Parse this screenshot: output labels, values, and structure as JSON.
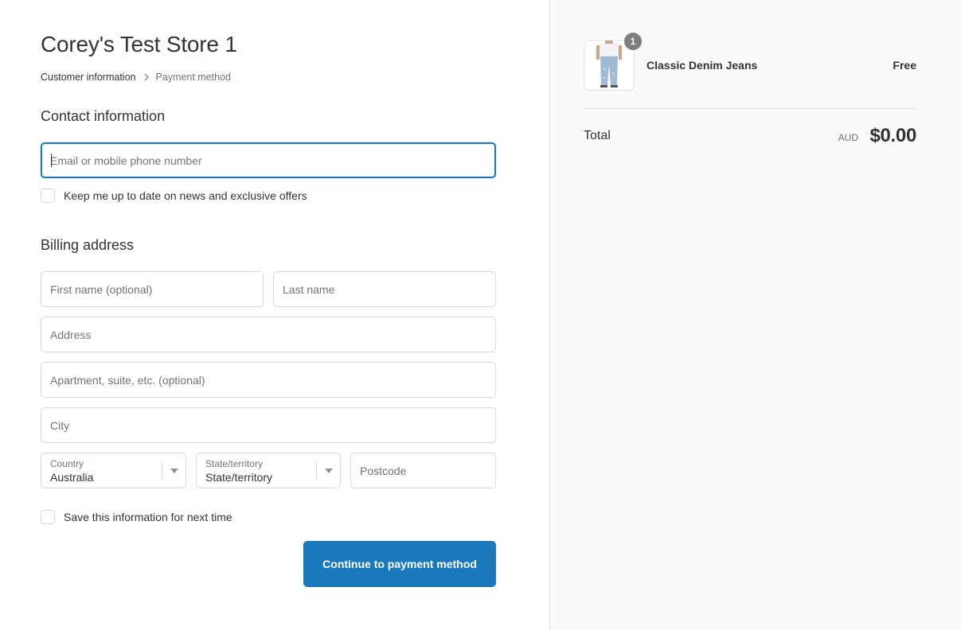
{
  "store": {
    "title": "Corey's Test Store 1"
  },
  "breadcrumb": {
    "current": "Customer information",
    "next": "Payment method"
  },
  "contact": {
    "section_title": "Contact information",
    "email_placeholder": "Email or mobile phone number",
    "email_value": "",
    "newsletter_label": "Keep me up to date on news and exclusive offers",
    "newsletter_checked": false
  },
  "billing": {
    "section_title": "Billing address",
    "first_name_placeholder": "First name (optional)",
    "last_name_placeholder": "Last name",
    "address_placeholder": "Address",
    "apartment_placeholder": "Apartment, suite, etc. (optional)",
    "city_placeholder": "City",
    "country_label": "Country",
    "country_value": "Australia",
    "state_label": "State/territory",
    "state_value": "State/territory",
    "postcode_placeholder": "Postcode",
    "save_info_label": "Save this information for next time",
    "save_info_checked": false
  },
  "actions": {
    "continue_label": "Continue to payment method"
  },
  "order_summary": {
    "items": [
      {
        "name": "Classic Denim Jeans",
        "price": "Free",
        "quantity": "1"
      }
    ],
    "total_label": "Total",
    "currency": "AUD",
    "total_amount": "$0.00"
  },
  "colors": {
    "accent": "#1979ba",
    "focus_border": "#1878b9",
    "sidebar_bg": "#fafafa",
    "border": "#d9d9d9"
  },
  "icons": {
    "breadcrumb_separator": "chevron-right-icon",
    "select_arrow": "caret-down-icon"
  }
}
